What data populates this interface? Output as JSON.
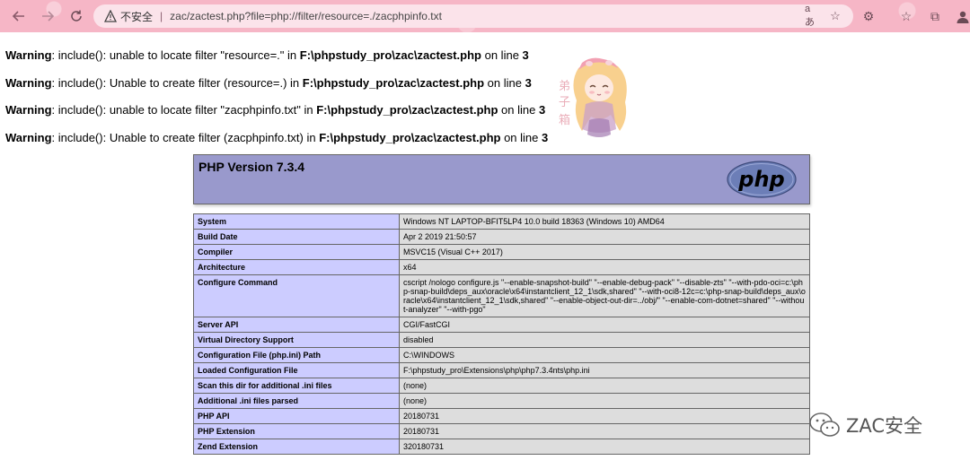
{
  "browser": {
    "insecure_label": "不安全",
    "separator": "|",
    "url": "zac/zactest.php?file=php://filter/resource=./zacphpinfo.txt",
    "read_aloud": "aあ"
  },
  "warnings": [
    {
      "label": "Warning",
      "mid": ": include(): unable to locate filter \"resource=.\" in ",
      "path": "F:\\phpstudy_pro\\zac\\zactest.php",
      "on": " on line ",
      "line": "3"
    },
    {
      "label": "Warning",
      "mid": ": include(): Unable to create filter (resource=.) in ",
      "path": "F:\\phpstudy_pro\\zac\\zactest.php",
      "on": " on line ",
      "line": "3"
    },
    {
      "label": "Warning",
      "mid": ": include(): unable to locate filter \"zacphpinfo.txt\" in ",
      "path": "F:\\phpstudy_pro\\zac\\zactest.php",
      "on": " on line ",
      "line": "3"
    },
    {
      "label": "Warning",
      "mid": ": include(): Unable to create filter (zacphpinfo.txt) in ",
      "path": "F:\\phpstudy_pro\\zac\\zactest.php",
      "on": " on line ",
      "line": "3"
    }
  ],
  "phpinfo": {
    "title": "PHP Version 7.3.4",
    "logo_text": "php",
    "rows": [
      {
        "key": "System",
        "value": "Windows NT LAPTOP-BFIT5LP4 10.0 build 18363 (Windows 10) AMD64"
      },
      {
        "key": "Build Date",
        "value": "Apr 2 2019 21:50:57"
      },
      {
        "key": "Compiler",
        "value": "MSVC15 (Visual C++ 2017)"
      },
      {
        "key": "Architecture",
        "value": "x64"
      },
      {
        "key": "Configure Command",
        "value": "cscript /nologo configure.js \"--enable-snapshot-build\" \"--enable-debug-pack\" \"--disable-zts\" \"--with-pdo-oci=c:\\php-snap-build\\deps_aux\\oracle\\x64\\instantclient_12_1\\sdk,shared\" \"--with-oci8-12c=c:\\php-snap-build\\deps_aux\\oracle\\x64\\instantclient_12_1\\sdk,shared\" \"--enable-object-out-dir=../obj/\" \"--enable-com-dotnet=shared\" \"--without-analyzer\" \"--with-pgo\""
      },
      {
        "key": "Server API",
        "value": "CGI/FastCGI"
      },
      {
        "key": "Virtual Directory Support",
        "value": "disabled"
      },
      {
        "key": "Configuration File (php.ini) Path",
        "value": "C:\\WINDOWS"
      },
      {
        "key": "Loaded Configuration File",
        "value": "F:\\phpstudy_pro\\Extensions\\php\\php7.3.4nts\\php.ini"
      },
      {
        "key": "Scan this dir for additional .ini files",
        "value": "(none)"
      },
      {
        "key": "Additional .ini files parsed",
        "value": "(none)"
      },
      {
        "key": "PHP API",
        "value": "20180731"
      },
      {
        "key": "PHP Extension",
        "value": "20180731"
      },
      {
        "key": "Zend Extension",
        "value": "320180731"
      }
    ]
  },
  "sticker": {
    "vertical_text": "弟子箱"
  },
  "watermark": {
    "text": "ZAC安全"
  },
  "colors": {
    "toolbar": "#f6b6c6",
    "php_header": "#9999cc",
    "key_cell": "#ccccff",
    "value_cell": "#dddddd"
  }
}
